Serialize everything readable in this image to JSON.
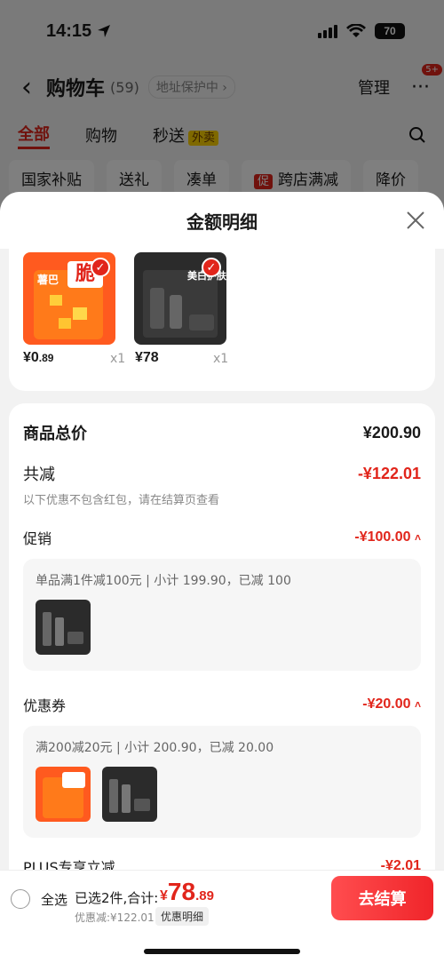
{
  "status_bar": {
    "time": "14:15",
    "battery": "70"
  },
  "cart_header": {
    "back": "‹",
    "title": "购物车",
    "count": "(59)",
    "address_protect": "地址保护中 ›",
    "manage": "管理",
    "more": "···",
    "badge": "5+"
  },
  "tabs": [
    {
      "label": "全部"
    },
    {
      "label": "购物"
    },
    {
      "label": "秒送"
    }
  ],
  "waimai_tag": "外卖",
  "chips": [
    {
      "label": "国家补贴"
    },
    {
      "label": "送礼"
    },
    {
      "label": "凑单"
    },
    {
      "label": "跨店满减",
      "tag": "促"
    },
    {
      "label": "降价"
    }
  ],
  "sheet": {
    "title": "金额明细"
  },
  "goods": [
    {
      "price_int": "¥0",
      "price_dec": ".89",
      "qty": "x1",
      "pack_brand": "脆",
      "pack_name": "薯巴"
    },
    {
      "price_int": "¥78",
      "price_dec": "",
      "qty": "x1",
      "pack_name": "美白护肤"
    }
  ],
  "summary": {
    "total_label": "商品总价",
    "total_value": "¥200.90",
    "reduce_label": "共减",
    "reduce_value": "-¥122.01",
    "note": "以下优惠不包含红包，请在结算页查看",
    "promo_label": "促销",
    "promo_value": "-¥100.00",
    "promo_line": "单品满1件减100元 | 小计 199.90，已减 100",
    "coupon_label": "优惠券",
    "coupon_value": "-¥20.00",
    "coupon_line": "满200减20元 | 小计 200.90，已减 20.00",
    "plus_label": "PLUS专享立减",
    "plus_value": "-¥2.01"
  },
  "bottom_bar": {
    "select_all": "全选",
    "selected": "已选2件,合计:",
    "yen": "¥",
    "int": "78",
    "dec": ".89",
    "saved": "优惠减:¥122.01",
    "detail": "优惠明细",
    "checkout": "去结算"
  },
  "colors": {
    "accent": "#e1251b"
  }
}
